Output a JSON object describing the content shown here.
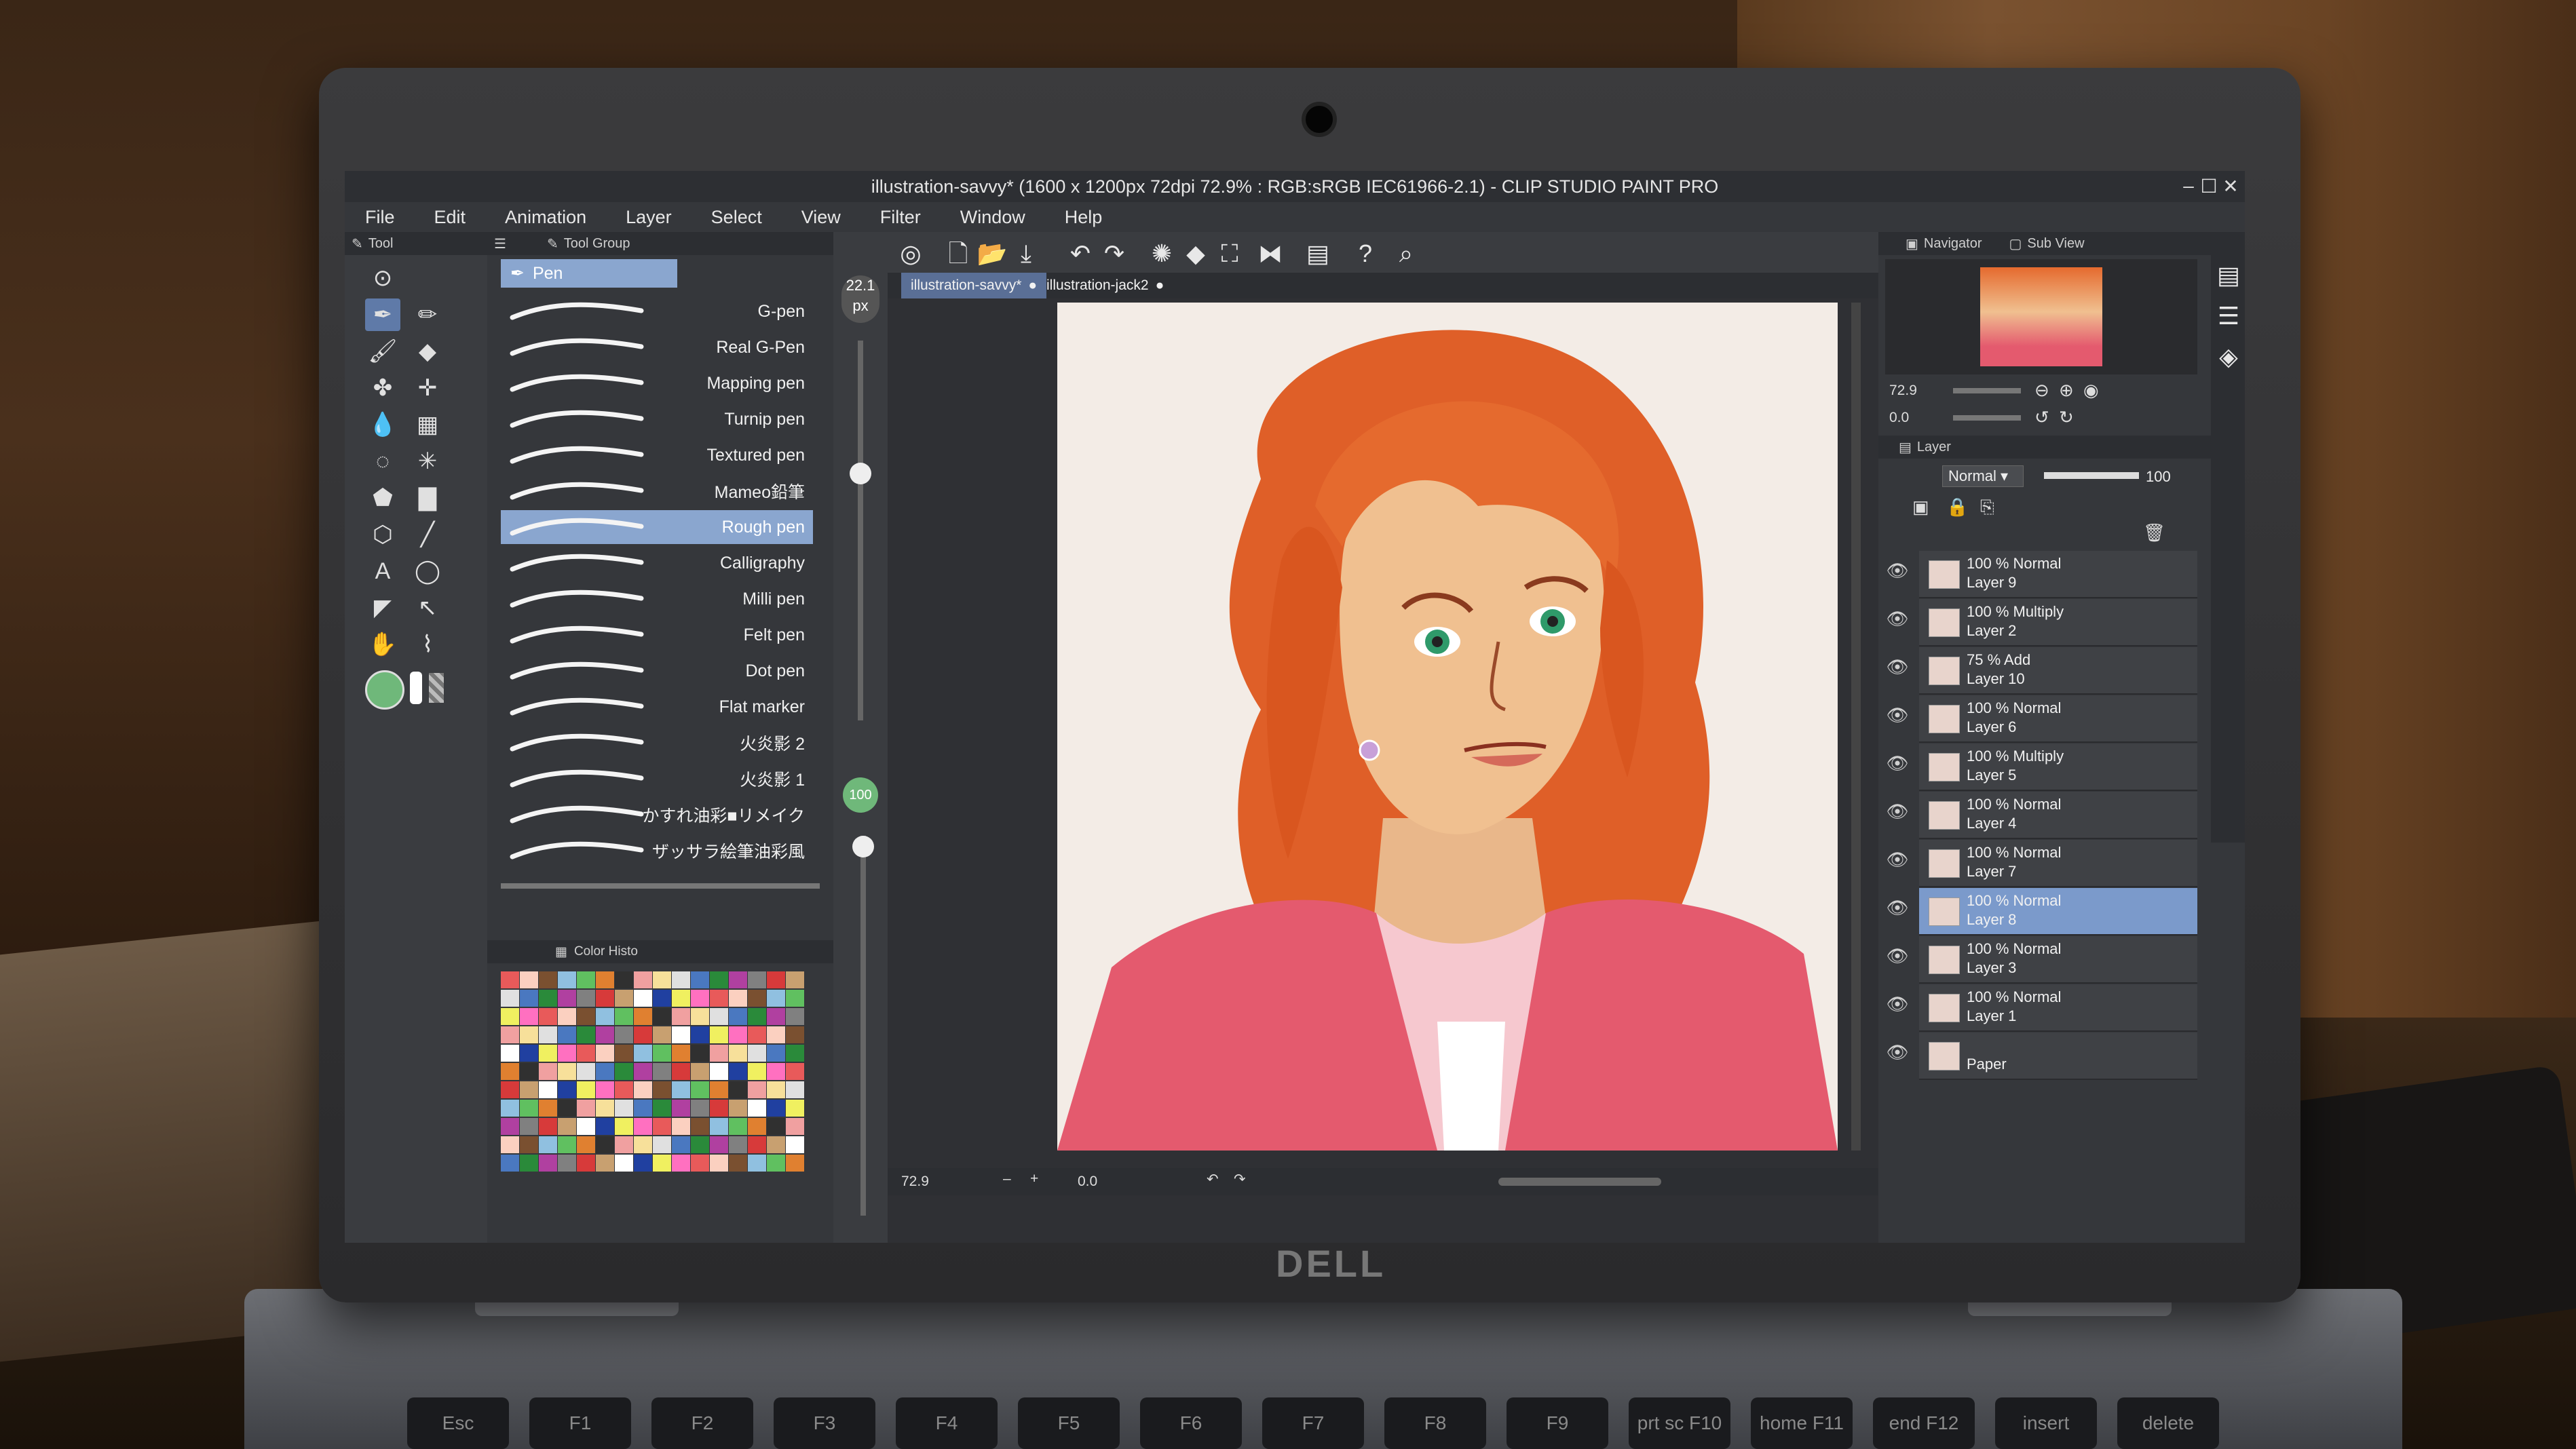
{
  "window": {
    "title": "illustration-savvy* (1600 x 1200px 72dpi 72.9% : RGB:sRGB IEC61966-2.1) - CLIP STUDIO PAINT PRO"
  },
  "menu": [
    "File",
    "Edit",
    "Animation",
    "Layer",
    "Select",
    "View",
    "Filter",
    "Window",
    "Help"
  ],
  "tool_panel": {
    "tab_tool": "Tool",
    "tab_tool_group": "Tool Group"
  },
  "subtool": {
    "group_label": "Pen",
    "brushes": [
      "G-pen",
      "Real G-Pen",
      "Mapping pen",
      "Turnip pen",
      "Textured pen",
      "Mameo鉛筆",
      "Rough pen",
      "Calligraphy",
      "Milli pen",
      "Felt pen",
      "Dot pen",
      "Flat marker",
      "火炎影 2",
      "火炎影 1",
      "かすれ油彩■リメイク",
      "ザッサラ絵筆油彩風"
    ],
    "selected": "Rough pen"
  },
  "brush_size": {
    "value": "22.1",
    "unit": "px"
  },
  "opacity_indicator": "100",
  "color_history": {
    "label": "Color Histo"
  },
  "canvas": {
    "tabs": [
      "illustration-savvy*",
      "illustration-jack2"
    ],
    "zoom": "72.9",
    "rotation": "0.0"
  },
  "navigator": {
    "tab_navigator": "Navigator",
    "tab_subview": "Sub View",
    "zoom": "72.9",
    "rotation": "0.0"
  },
  "layer_panel": {
    "tab": "Layer",
    "blend_mode": "Normal",
    "opacity": "100",
    "layers": [
      {
        "top": "100 % Normal",
        "name": "Layer 9"
      },
      {
        "top": "100 % Multiply",
        "name": "Layer 2"
      },
      {
        "top": "75 % Add",
        "name": "Layer 10"
      },
      {
        "top": "100 % Normal",
        "name": "Layer 6"
      },
      {
        "top": "100 % Multiply",
        "name": "Layer 5"
      },
      {
        "top": "100 % Normal",
        "name": "Layer 4"
      },
      {
        "top": "100 % Normal",
        "name": "Layer 7"
      },
      {
        "top": "100 % Normal",
        "name": "Layer 8"
      },
      {
        "top": "100 % Normal",
        "name": "Layer 3"
      },
      {
        "top": "100 % Normal",
        "name": "Layer 1"
      },
      {
        "top": "",
        "name": "Paper"
      }
    ],
    "selected_layer": "Layer 8"
  },
  "laptop": {
    "brand": "DELL"
  },
  "keyboard": [
    "Esc",
    "F1",
    "F2",
    "F3",
    "F4",
    "F5",
    "F6",
    "F7",
    "F8",
    "F9",
    "prt sc F10",
    "home F11",
    "end F12",
    "insert",
    "delete"
  ],
  "colors": {
    "accent_selection": "#8aa6cf",
    "hair": "#e0622a",
    "jacket": "#e45a6e"
  }
}
